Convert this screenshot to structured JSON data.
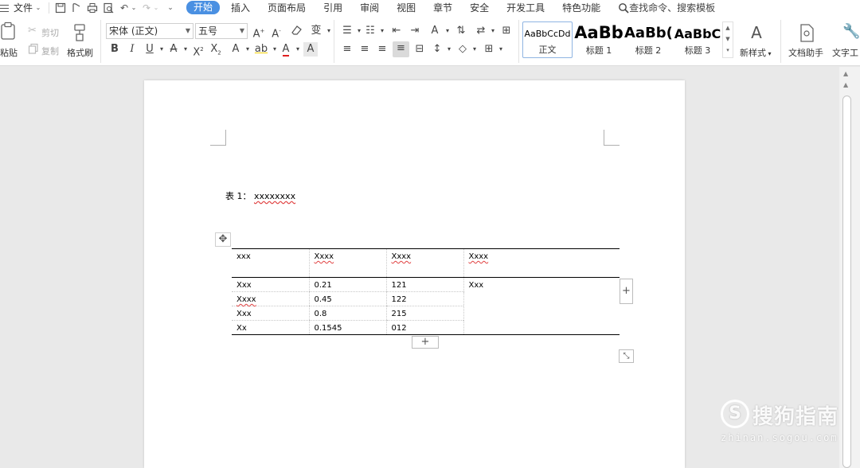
{
  "menubar": {
    "file_label": "文件",
    "tabs": [
      {
        "label": "开始",
        "active": true
      },
      {
        "label": "插入"
      },
      {
        "label": "页面布局"
      },
      {
        "label": "引用"
      },
      {
        "label": "审阅"
      },
      {
        "label": "视图"
      },
      {
        "label": "章节"
      },
      {
        "label": "安全"
      },
      {
        "label": "开发工具"
      },
      {
        "label": "特色功能"
      }
    ],
    "search_text": "查找命令、搜索模板"
  },
  "ribbon": {
    "paste_label": "粘贴",
    "cut_label": "剪切",
    "copy_label": "复制",
    "format_painter_label": "格式刷",
    "font_name": "宋体 (正文)",
    "font_size": "五号",
    "styles": [
      {
        "sample": "AaBbCcDd",
        "label": "正文"
      },
      {
        "sample": "AaBb",
        "label": "标题 1"
      },
      {
        "sample": "AaBb(",
        "label": "标题 2"
      },
      {
        "sample": "AaBbC",
        "label": "标题 3"
      }
    ],
    "new_style_label": "新样式",
    "doc_assistant_label": "文档助手",
    "text_tools_label": "文字工"
  },
  "document": {
    "caption_prefix": "表 1：",
    "caption_text": "xxxxxxxx",
    "table": {
      "headers": [
        "xxx",
        "Xxxx",
        "Xxxx",
        "Xxxx"
      ],
      "rows": [
        [
          "Xxx",
          "0.21",
          "121"
        ],
        [
          "Xxxx",
          "0.45",
          "122"
        ],
        [
          "Xxx",
          "0.8",
          "215"
        ],
        [
          "Xx",
          "0.1545",
          "012"
        ]
      ],
      "merged_cell": "Xxx"
    }
  },
  "watermark": {
    "name": "搜狗指南",
    "url": "zhinan.sogou.com"
  },
  "colors": {
    "accent": "#4a90e2",
    "spellcheck": "#e04040",
    "workspace_bg": "#e9e9e9"
  }
}
